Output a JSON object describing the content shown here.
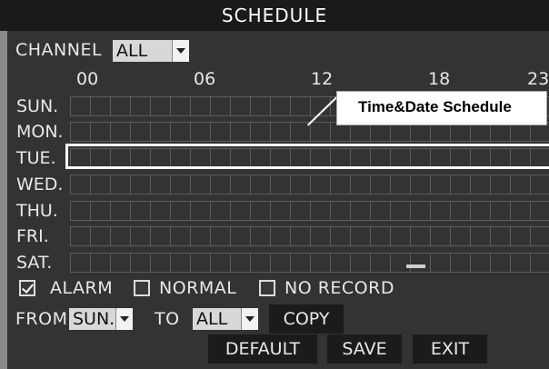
{
  "title": "SCHEDULE",
  "channel": {
    "label": "CHANNEL",
    "value": "ALL"
  },
  "hours": [
    "00",
    "06",
    "12",
    "18",
    "23"
  ],
  "days": [
    "SUN.",
    "MON.",
    "TUE.",
    "WED.",
    "THU.",
    "FRI.",
    "SAT."
  ],
  "highlight": {
    "day": "TUE.",
    "callout": "Time&Date Schedule"
  },
  "options": [
    {
      "label": "ALARM",
      "checked": true
    },
    {
      "label": "NORMAL",
      "checked": false
    },
    {
      "label": "NO RECORD",
      "checked": false
    }
  ],
  "copy_row": {
    "from_label": "FROM",
    "from_value": "SUN.",
    "to_label": "TO",
    "to_value": "ALL",
    "copy_button": "COPY"
  },
  "buttons": {
    "default": "DEFAULT",
    "save": "SAVE",
    "exit": "EXIT"
  },
  "colors": {
    "background": "#333333",
    "grid_line": "#5d5d5d",
    "titlebar": "#1a1a1a",
    "text": "#e8e8e8"
  }
}
